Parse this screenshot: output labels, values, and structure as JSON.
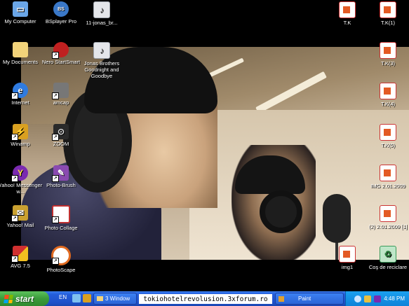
{
  "desktop_icons_left": [
    {
      "label": "My Computer",
      "icon": "computer-icon",
      "color": "#6aa6e8"
    },
    {
      "label": "My Documents",
      "icon": "folder-icon",
      "color": "#f2d37a"
    },
    {
      "label": "Internet",
      "icon": "ie-icon",
      "color": "#2f7be0"
    },
    {
      "label": "Winamp",
      "icon": "winamp-icon",
      "color": "#d9a020"
    },
    {
      "label": "Yahoo! Messenger w...",
      "icon": "yahoo-messenger-icon",
      "color": "#7a2ab0"
    },
    {
      "label": "Yahoo! Mail",
      "icon": "yahoo-mail-icon",
      "color": "#c9a030"
    },
    {
      "label": "AVG 7.5",
      "icon": "avg-icon",
      "color": "#d03030"
    }
  ],
  "desktop_icons_middle": [
    {
      "label": "BSplayer Pro",
      "icon": "bsplayer-icon",
      "color": "#3a78c8"
    },
    {
      "label": "Nero StartSmart",
      "icon": "nero-icon",
      "color": "#c02020"
    },
    {
      "label": "amcap",
      "icon": "amcap-icon",
      "color": "#777777"
    },
    {
      "label": "ZOOM",
      "icon": "zoom-icon",
      "color": "#2a2a2a"
    },
    {
      "label": "Photo-Brush",
      "icon": "photo-brush-icon",
      "color": "#8a4ab0"
    },
    {
      "label": "Photo Collage",
      "icon": "photo-collage-icon",
      "color": "#c03030"
    },
    {
      "label": "PhotoScape",
      "icon": "photoscape-icon",
      "color": "#e06a20"
    }
  ],
  "desktop_icons_third": [
    {
      "label": "11-jonas_br...",
      "icon": "audio-file-icon",
      "color": "#9aa0a8"
    },
    {
      "label": "Jonas Brothers Goodnight and Goodbye",
      "icon": "audio-file-icon",
      "color": "#9aa0a8"
    }
  ],
  "desktop_icons_right": [
    {
      "label": "T.K",
      "icon": "image-file-icon"
    },
    {
      "label": "T.K(1)",
      "icon": "image-file-icon"
    },
    {
      "label": "T.K(3)",
      "icon": "image-file-icon"
    },
    {
      "label": "T.K(4)",
      "icon": "image-file-icon"
    },
    {
      "label": "T.K(5)",
      "icon": "image-file-icon"
    },
    {
      "label": "IMG 2.01.2009",
      "icon": "image-file-icon"
    },
    {
      "label": "(2) 2.01.2009 [1]",
      "icon": "image-file-icon"
    },
    {
      "label": "img1",
      "icon": "image-file-icon"
    },
    {
      "label": "Coş de reciclare",
      "icon": "recycle-bin-icon"
    }
  ],
  "taskbar": {
    "start_label": "start",
    "language": "EN",
    "task_1": "3 Window",
    "task_2": "Paint",
    "watermark": "tokiohotelrevolusion.3xforum.ro",
    "clock": "4:48 PM"
  },
  "colors": {
    "taskbar_blue": "#245edb",
    "start_green": "#3a9b3a",
    "tray_blue": "#0f82d8"
  }
}
